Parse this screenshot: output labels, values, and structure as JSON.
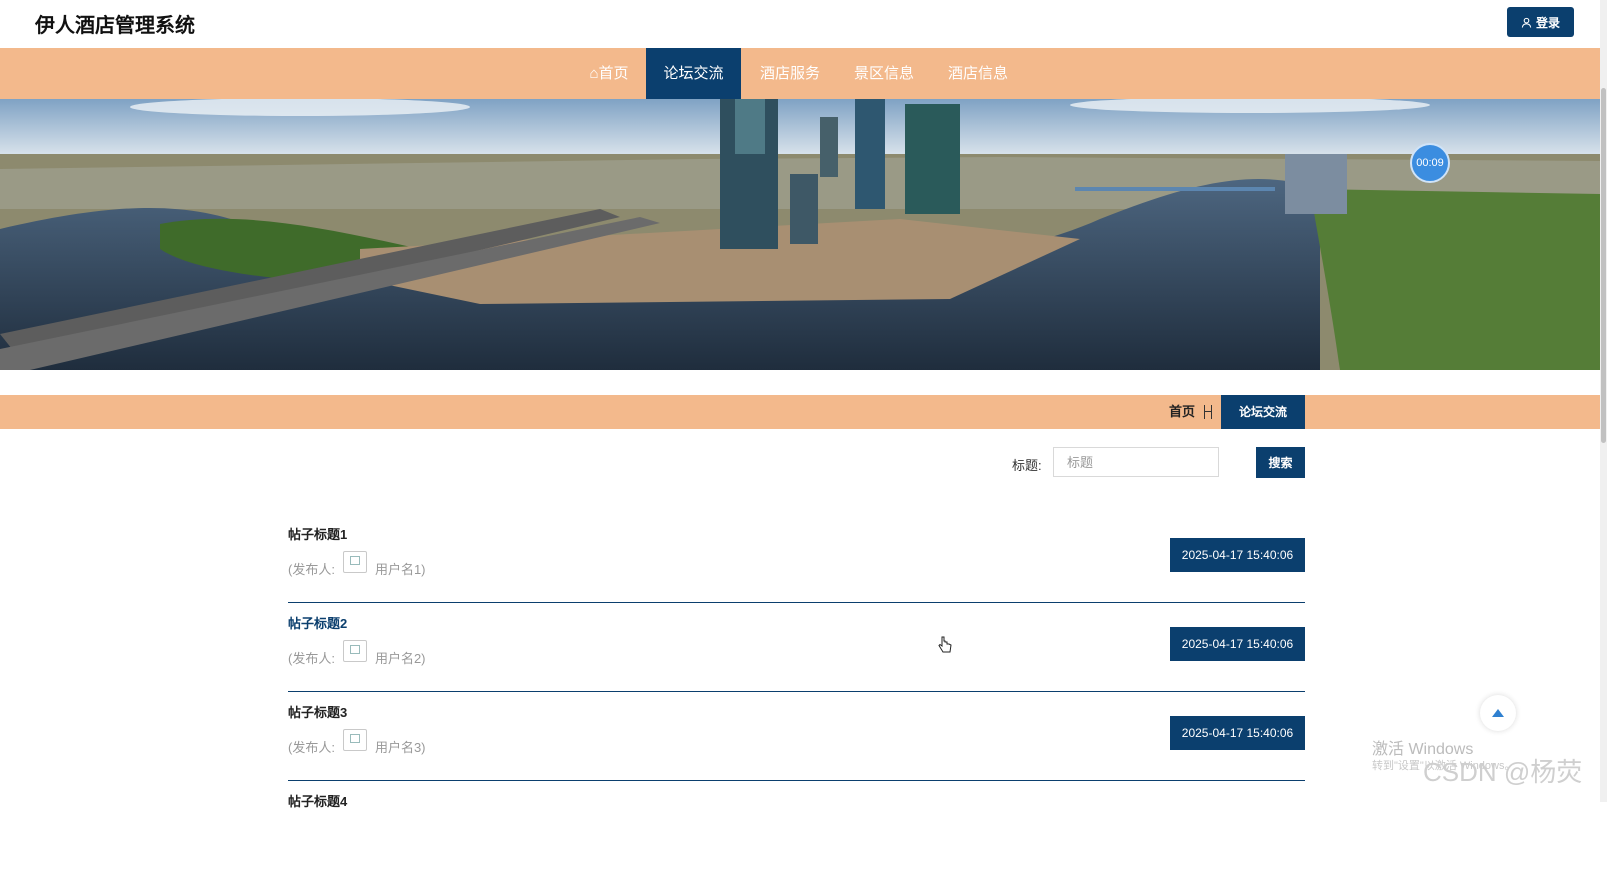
{
  "header": {
    "site_title": "伊人酒店管理系统",
    "login_label": "登录"
  },
  "nav": {
    "items": [
      {
        "label": "⌂首页",
        "active": false
      },
      {
        "label": "论坛交流",
        "active": true
      },
      {
        "label": "酒店服务",
        "active": false
      },
      {
        "label": "景区信息",
        "active": false
      },
      {
        "label": "酒店信息",
        "active": false
      }
    ]
  },
  "banner": {
    "timer": "00:09"
  },
  "breadcrumb": {
    "home": "首页",
    "current": "论坛交流"
  },
  "search": {
    "label": "标题:",
    "placeholder": "标题",
    "value": "",
    "button": "搜索"
  },
  "posts": [
    {
      "title": "帖子标题1",
      "publisher_label": "(发布人:",
      "user": "用户名1)",
      "time": "2025-04-17 15:40:06"
    },
    {
      "title": "帖子标题2",
      "publisher_label": "(发布人:",
      "user": "用户名2)",
      "time": "2025-04-17 15:40:06"
    },
    {
      "title": "帖子标题3",
      "publisher_label": "(发布人:",
      "user": "用户名3)",
      "time": "2025-04-17 15:40:06"
    },
    {
      "title": "帖子标题4",
      "publisher_label": "",
      "user": "",
      "time": ""
    }
  ],
  "overlay": {
    "activate_windows": "激活 Windows",
    "activate_hint": "转到\"设置\"以激活 Windows。",
    "csdn": "CSDN @杨荧"
  },
  "colors": {
    "primary": "#0b3f6e",
    "accent": "#f3b98c"
  }
}
